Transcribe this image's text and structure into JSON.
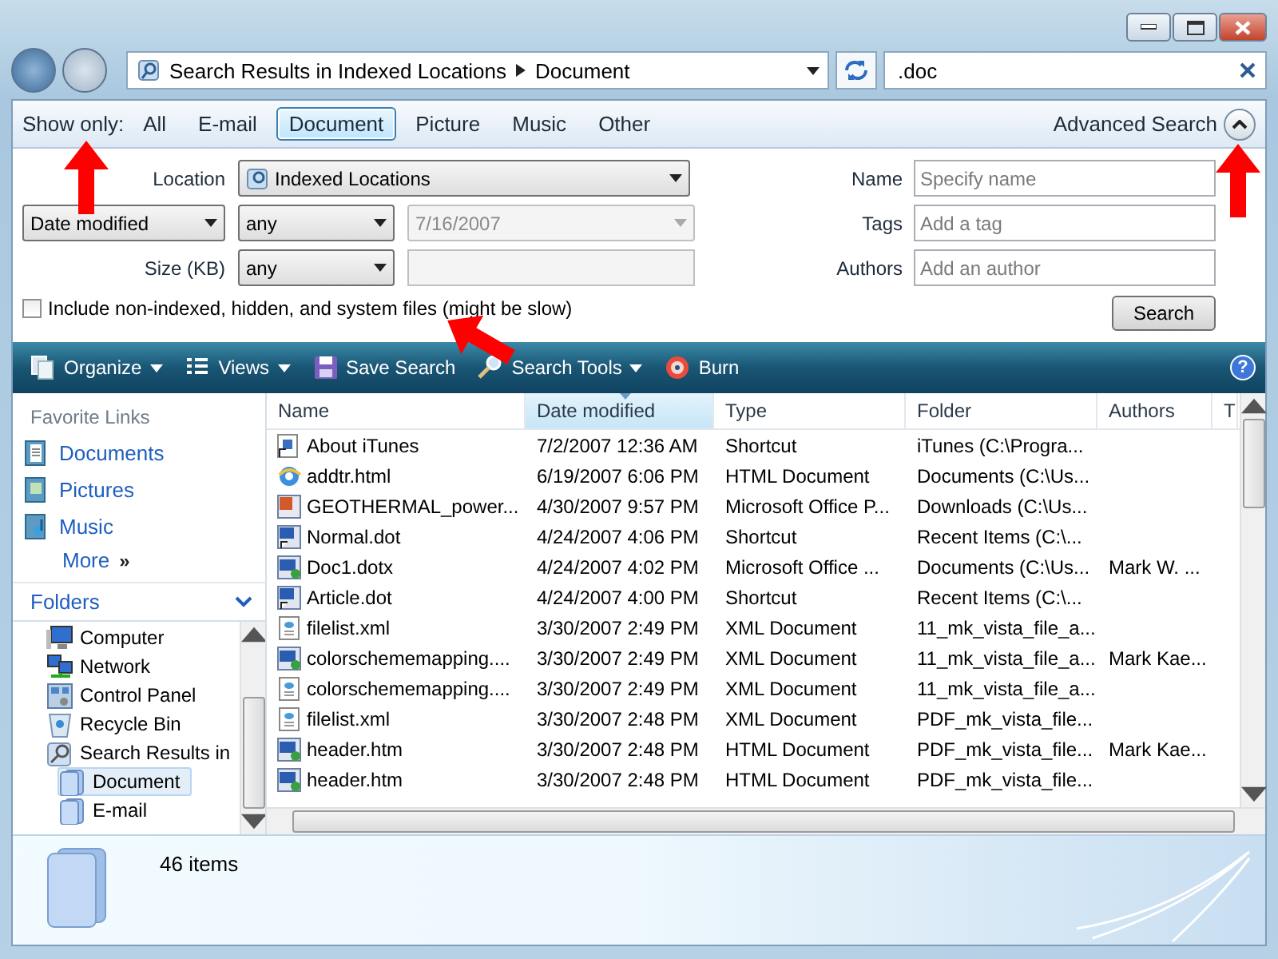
{
  "address_bar": {
    "breadcrumbs": [
      "Search Results in Indexed Locations",
      "Document"
    ]
  },
  "search_box": {
    "value": ".doc"
  },
  "filter_bar": {
    "label": "Show only:",
    "annotated": true,
    "filters": [
      {
        "label": "All",
        "selected": false
      },
      {
        "label": "E-mail",
        "selected": false
      },
      {
        "label": "Document",
        "selected": true
      },
      {
        "label": "Picture",
        "selected": false
      },
      {
        "label": "Music",
        "selected": false
      },
      {
        "label": "Other",
        "selected": false
      }
    ],
    "advanced_search": {
      "label": "Advanced Search",
      "expanded": true,
      "annotated": true
    }
  },
  "advanced_search": {
    "location": {
      "label": "Location",
      "value": "Indexed Locations"
    },
    "date": {
      "field": "Date modified",
      "condition": "any",
      "value": "7/16/2007",
      "disabled": true
    },
    "size": {
      "label": "Size (KB)",
      "condition": "any"
    },
    "include_nonindexed": {
      "label": "Include non-indexed, hidden, and system files (might be slow)",
      "checked": false
    },
    "fields": [
      {
        "label": "Name",
        "placeholder": "Specify name"
      },
      {
        "label": "Tags",
        "placeholder": "Add a tag"
      },
      {
        "label": "Authors",
        "placeholder": "Add an author"
      }
    ],
    "search_button": "Search"
  },
  "toolbar": {
    "help": "?",
    "items": [
      {
        "kind": "organize",
        "label": "Organize",
        "menu": true,
        "annotated": false
      },
      {
        "kind": "views",
        "label": "Views",
        "menu": true,
        "annotated": false
      },
      {
        "kind": "save",
        "label": "Save Search",
        "menu": false,
        "annotated": true
      },
      {
        "kind": "tools",
        "label": "Search Tools",
        "menu": true,
        "annotated": false
      },
      {
        "kind": "burn",
        "label": "Burn",
        "menu": false,
        "annotated": false
      }
    ]
  },
  "sidebar": {
    "favorite_links": {
      "title": "Favorite Links",
      "items": [
        "Documents",
        "Pictures",
        "Music"
      ],
      "more": {
        "label": "More",
        "chevron": "»"
      }
    },
    "folders": {
      "title": "Folders",
      "expanded": true,
      "items": [
        {
          "kind": "computer",
          "label": "Computer",
          "selected": false
        },
        {
          "kind": "network",
          "label": "Network",
          "selected": false
        },
        {
          "kind": "panel",
          "label": "Control Panel",
          "selected": false
        },
        {
          "kind": "bin",
          "label": "Recycle Bin",
          "selected": false
        },
        {
          "kind": "search",
          "label": "Search Results in",
          "selected": false,
          "children": [
            {
              "kind": "stack",
              "label": "Document",
              "selected": true
            },
            {
              "kind": "stack",
              "label": "E-mail",
              "selected": false
            }
          ]
        }
      ]
    }
  },
  "table": {
    "columns": [
      {
        "label": "Name",
        "sorted": false
      },
      {
        "label": "Date modified",
        "sorted": true
      },
      {
        "label": "Type",
        "sorted": false
      },
      {
        "label": "Folder",
        "sorted": false
      },
      {
        "label": "Authors",
        "sorted": false
      },
      {
        "label": "T",
        "sorted": false
      }
    ],
    "rows": [
      {
        "kind": "shortcut",
        "cells": [
          "About iTunes",
          "7/2/2007 12:36 AM",
          "Shortcut",
          "iTunes (C:\\Progra...",
          ""
        ]
      },
      {
        "kind": "web",
        "cells": [
          "addtr.html",
          "6/19/2007 6:06 PM",
          "HTML Document",
          "Documents (C:\\Us...",
          ""
        ]
      },
      {
        "kind": "presentation",
        "cells": [
          "GEOTHERMAL_power...",
          "4/30/2007 9:57 PM",
          "Microsoft Office P...",
          "Downloads (C:\\Us...",
          ""
        ]
      },
      {
        "kind": "template",
        "cells": [
          "Normal.dot",
          "4/24/2007 4:06 PM",
          "Shortcut",
          "Recent Items (C:\\...",
          ""
        ]
      },
      {
        "kind": "document",
        "cells": [
          "Doc1.dotx",
          "4/24/2007 4:02 PM",
          "Microsoft Office ...",
          "Documents (C:\\Us...",
          "Mark W. ..."
        ]
      },
      {
        "kind": "template",
        "cells": [
          "Article.dot",
          "4/24/2007 4:00 PM",
          "Shortcut",
          "Recent Items (C:\\...",
          ""
        ]
      },
      {
        "kind": "xml",
        "cells": [
          "filelist.xml",
          "3/30/2007 2:49 PM",
          "XML Document",
          "11_mk_vista_file_a...",
          ""
        ]
      },
      {
        "kind": "document",
        "cells": [
          "colorschememapping....",
          "3/30/2007 2:49 PM",
          "XML Document",
          "11_mk_vista_file_a...",
          "Mark Kae..."
        ]
      },
      {
        "kind": "xml",
        "cells": [
          "colorschememapping....",
          "3/30/2007 2:49 PM",
          "XML Document",
          "11_mk_vista_file_a...",
          ""
        ]
      },
      {
        "kind": "xml",
        "cells": [
          "filelist.xml",
          "3/30/2007 2:48 PM",
          "XML Document",
          "PDF_mk_vista_file...",
          ""
        ]
      },
      {
        "kind": "document",
        "cells": [
          "header.htm",
          "3/30/2007 2:48 PM",
          "HTML Document",
          "PDF_mk_vista_file...",
          "Mark Kae..."
        ]
      },
      {
        "kind": "document",
        "cells": [
          "header.htm",
          "3/30/2007 2:48 PM",
          "HTML Document",
          "PDF_mk_vista_file...",
          ""
        ]
      }
    ]
  },
  "status_bar": {
    "item_count": "46 items"
  }
}
